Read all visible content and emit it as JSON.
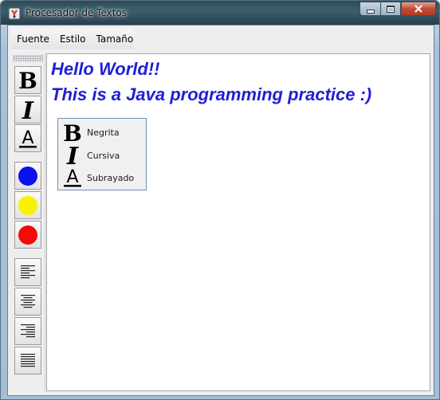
{
  "window": {
    "title": "Procesador de Textos"
  },
  "menubar": {
    "items": [
      {
        "label": "Fuente"
      },
      {
        "label": "Estilo"
      },
      {
        "label": "Tamaño"
      }
    ]
  },
  "toolbar": {
    "buttons": [
      {
        "icon": "bold-icon",
        "glyph": "B"
      },
      {
        "icon": "italic-icon",
        "glyph": "I"
      },
      {
        "icon": "underline-icon",
        "glyph": "A"
      },
      {
        "icon": "blue-color-icon",
        "color": "#0a10f0"
      },
      {
        "icon": "yellow-color-icon",
        "color": "#f7f200"
      },
      {
        "icon": "red-color-icon",
        "color": "#f50a0a"
      },
      {
        "icon": "align-left-icon"
      },
      {
        "icon": "align-center-icon"
      },
      {
        "icon": "align-right-icon"
      },
      {
        "icon": "align-justify-icon"
      }
    ]
  },
  "editor": {
    "lines": [
      "Hello World!!",
      "This is a Java programming practice :)"
    ],
    "text_color": "#1f1fd6"
  },
  "popup_menu": {
    "items": [
      {
        "label": "Negrita",
        "glyph": "B"
      },
      {
        "label": "Cursiva",
        "glyph": "I"
      },
      {
        "label": "Subrayado",
        "glyph": "A"
      }
    ]
  }
}
